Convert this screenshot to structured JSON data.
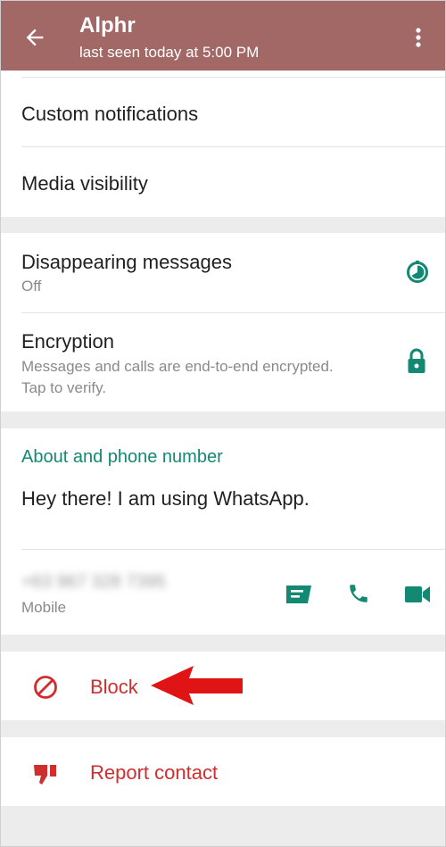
{
  "header": {
    "title": "Alphr",
    "subtitle": "last seen today at 5:00 PM",
    "back_icon": "arrow-left-icon",
    "menu_icon": "more-vert-icon"
  },
  "settings": {
    "custom_notifications": "Custom notifications",
    "media_visibility": "Media visibility",
    "disappearing_title": "Disappearing messages",
    "disappearing_value": "Off",
    "encryption_title": "Encryption",
    "encryption_desc_line1": "Messages and calls are end-to-end encrypted.",
    "encryption_desc_line2": "Tap to verify."
  },
  "about": {
    "section_title": "About and phone number",
    "status": "Hey there! I am using WhatsApp.",
    "phone_blurred": "+63 967 328 7395",
    "phone_type": "Mobile"
  },
  "actions": {
    "block_label": "Block",
    "report_label": "Report contact"
  },
  "colors": {
    "appbar": "#a26866",
    "accent_teal": "#138872",
    "danger_red": "#cf2e2e",
    "annotation_arrow": "#e01414"
  }
}
